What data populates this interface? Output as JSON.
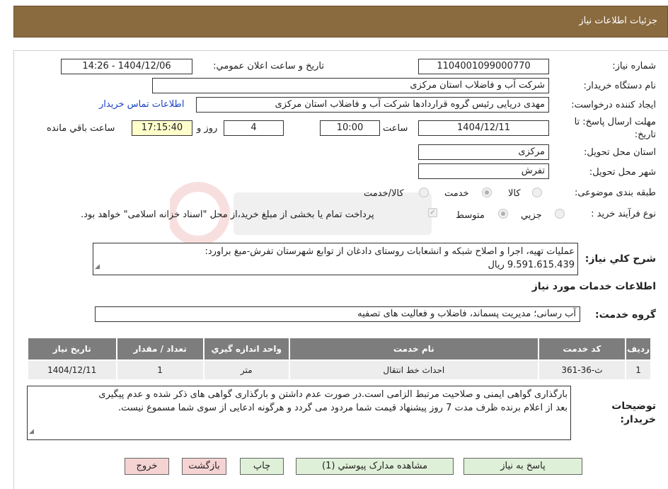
{
  "header": {
    "title": "جزئیات اطلاعات نیاز"
  },
  "fields": {
    "need_number_label": "شماره نیاز:",
    "need_number": "1104001099000770",
    "announce_label": "تاریخ و ساعت اعلان عمومي:",
    "announce_value": "1404/12/06 - 14:26",
    "buyer_label": "نام دستگاه خريدار:",
    "buyer": "شرکت آب و فاضلاب استان مرکزی",
    "creator_label": "ايجاد کننده درخواست:",
    "creator": "مهدی دریایی رئیس گروه قراردادها شرکت آب و فاضلاب استان مرکزی",
    "contact_link": "اطلاعات تماس خريدار",
    "deadline_label": "مهلت ارسال پاسخ: تا تاریخ:",
    "deadline_date": "1404/12/11",
    "time_label": "ساعت",
    "deadline_time": "10:00",
    "days_value": "4",
    "days_label": "روز و",
    "remaining_time": "17:15:40",
    "remaining_label": "ساعت باقي مانده",
    "province_label": "استان محل تحویل:",
    "province": "مرکزی",
    "city_label": "شهر محل تحویل:",
    "city": "تفرش",
    "category_label": "طبقه بندی موضوعی:",
    "category_options": [
      "کالا",
      "خدمت",
      "کالا/خدمت"
    ],
    "process_label": "نوع فرآیند خرید :",
    "process_options": [
      "جزيي",
      "متوسط"
    ],
    "payment_note": "پرداخت تمام یا بخشی از مبلغ خرید،از محل \"اسناد خزانه اسلامی\" خواهد بود."
  },
  "description": {
    "label": "شرح کلي نياز:",
    "text_line1": "عملیات تهیه، اجرا و اصلاح شبکه و انشعابات روستای دادغان از توابع شهرستان تفرش-مبغ براورد:",
    "text_line2": "9.591.615.439 ریال"
  },
  "services": {
    "title": "اطلاعات خدمات مورد نياز",
    "group_label": "گروه خدمت:",
    "group_value": "آب رسانی؛ مدیریت پسماند، فاضلاب و فعالیت های تصفیه",
    "columns": [
      "رديف",
      "کد خدمت",
      "نام خدمت",
      "واحد اندازه گيري",
      "تعداد / مقدار",
      "تاريخ نياز"
    ],
    "rows": [
      {
        "row": "1",
        "code": "ث-36-361",
        "name": "احداث خط انتقال",
        "unit": "متر",
        "qty": "1",
        "date": "1404/12/11"
      }
    ]
  },
  "buyer_notes": {
    "label_line1": "توضيحات",
    "label_line2": "خريدار:",
    "line1": "بارگذاری گواهی ایمنی و صلاحیت مرتبط الزامی است.در صورت عدم داشتن و بارگذاری گواهی های ذکر شده و عدم پیگیری",
    "line2": "بعد از اعلام برنده ظرف مدت 7 روز پیشنهاد قیمت شما مردود می گردد و هرگونه ادعایی از سوی شما مسموع نیست."
  },
  "buttons": {
    "reply": "پاسخ به نياز",
    "attachments": "مشاهده مدارک پيوستي (1)",
    "print": "چاپ",
    "back": "بازگشت",
    "exit": "خروج"
  },
  "colors": {
    "header_bg": "#8a6a3f",
    "table_header": "#7d7d7d",
    "button_green": "#dff0d8",
    "button_pink": "#f6d3d3",
    "link": "#1a44c4"
  }
}
